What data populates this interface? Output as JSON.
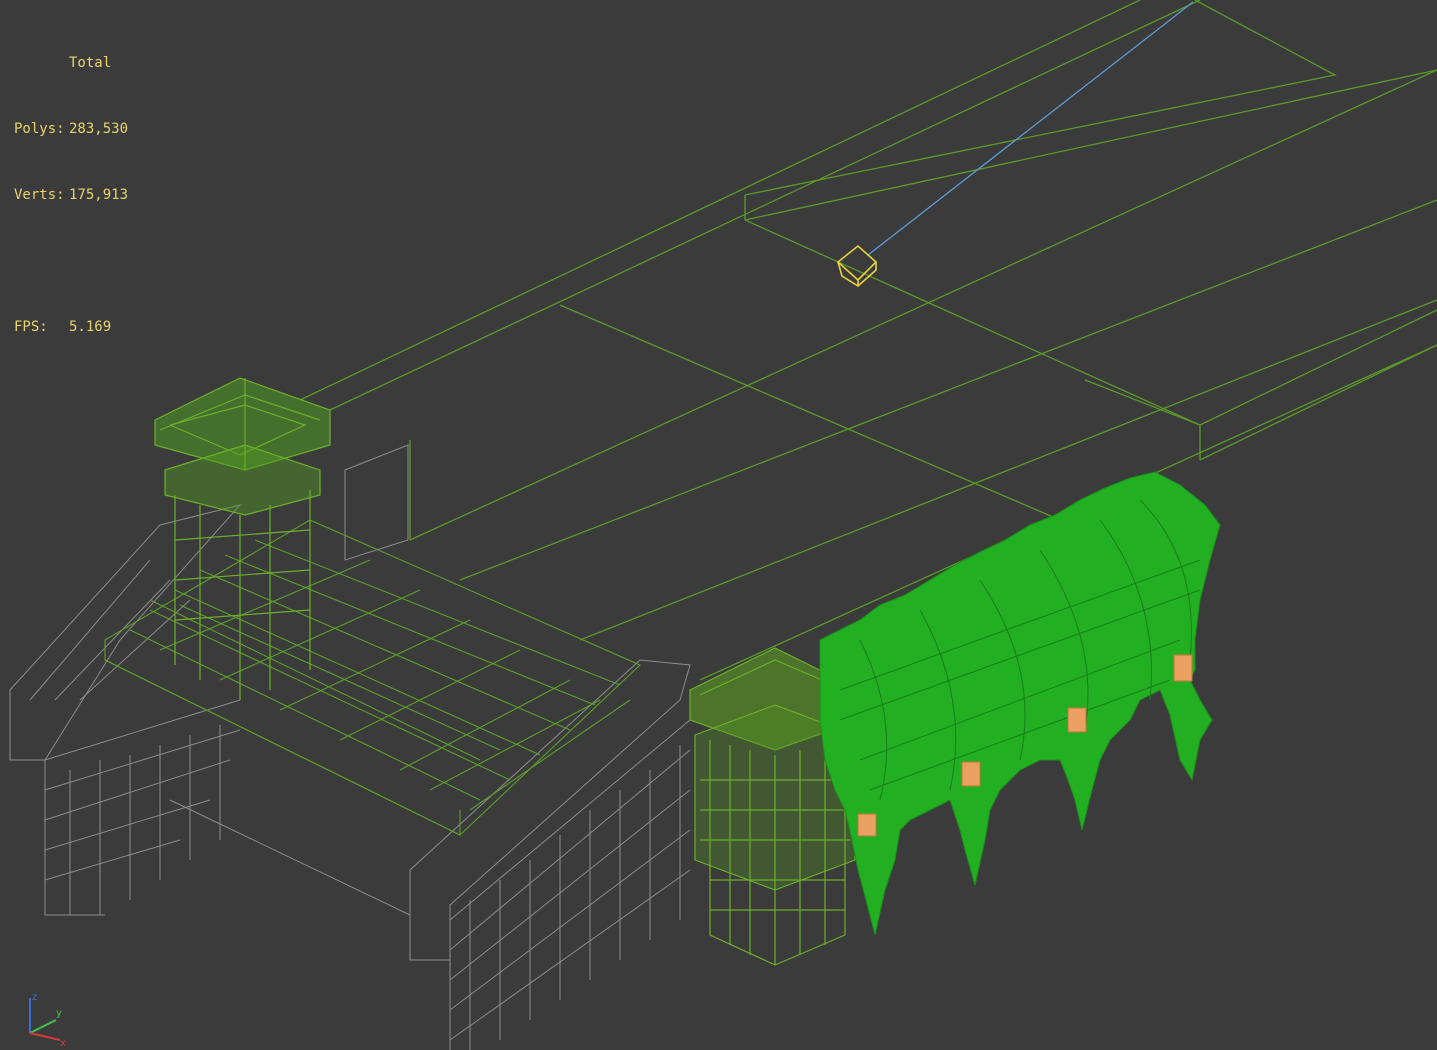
{
  "viewport": {
    "background": "#3b3b3b",
    "wire_green": "#5fa22a",
    "solid_green": "#22b022",
    "grey_wire": "#8a8a8a",
    "selected_yellow": "#e8d23c",
    "light_blue": "#5a9ad8",
    "accent_orange": "#e9a060"
  },
  "stats": {
    "title": "Total",
    "polys_label": "Polys:",
    "polys_value": "283,530",
    "verts_label": "Verts:",
    "verts_value": "175,913",
    "fps_label": "FPS:",
    "fps_value": "5.169"
  },
  "axis_gizmo": {
    "z_label": "z",
    "y_label": "y",
    "x_label": "x",
    "z_color": "#3d6cd6",
    "y_color": "#3fc24a",
    "x_color": "#d23a3a"
  }
}
